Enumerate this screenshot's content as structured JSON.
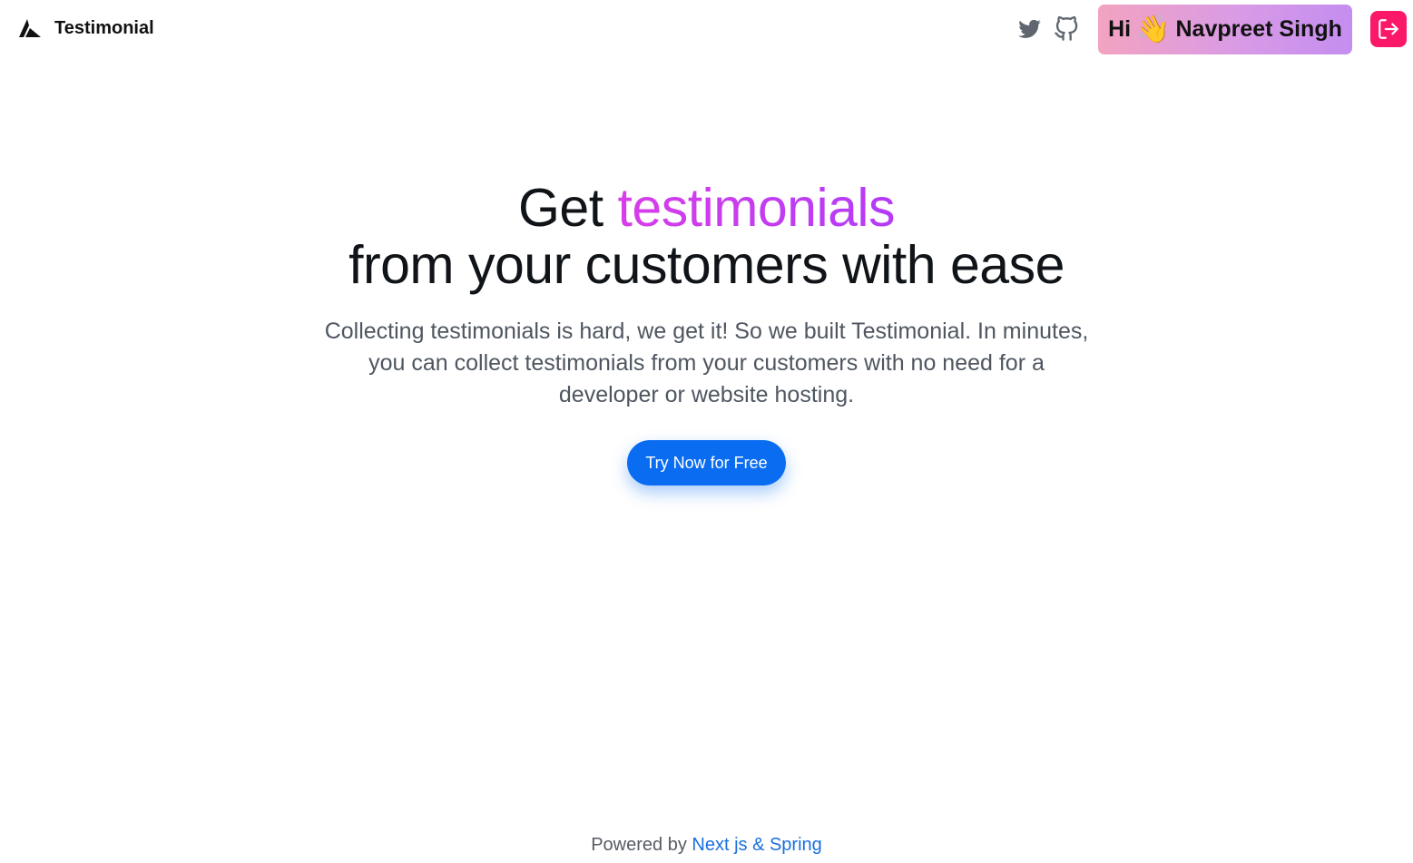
{
  "header": {
    "brand_name": "Testimonial",
    "greeting_prefix": "Hi",
    "greeting_emoji": "👋",
    "user_name": "Navpreet Singh",
    "icons": {
      "logo": "testimonial-logo-icon",
      "twitter": "twitter-icon",
      "github": "github-icon",
      "logout": "logout-icon"
    },
    "colors": {
      "logout_bg": "#fb1869",
      "greeting_gradient_start": "#f3a3c0",
      "greeting_gradient_end": "#c48df0"
    }
  },
  "hero": {
    "title_prefix": "Get",
    "title_highlight": "testimonials",
    "title_line2": "from your customers with ease",
    "subtitle": "Collecting testimonials is hard, we get it! So we built Testimonial. In minutes, you can collect testimonials from your customers with no need for a developer or website hosting.",
    "cta_label": "Try Now for Free",
    "colors": {
      "highlight": "#cc3ef0",
      "cta": "#0a6cf0"
    }
  },
  "footer": {
    "prefix": "Powered by",
    "link_text": "Next js & Spring",
    "link_color": "#1a6fe0"
  }
}
